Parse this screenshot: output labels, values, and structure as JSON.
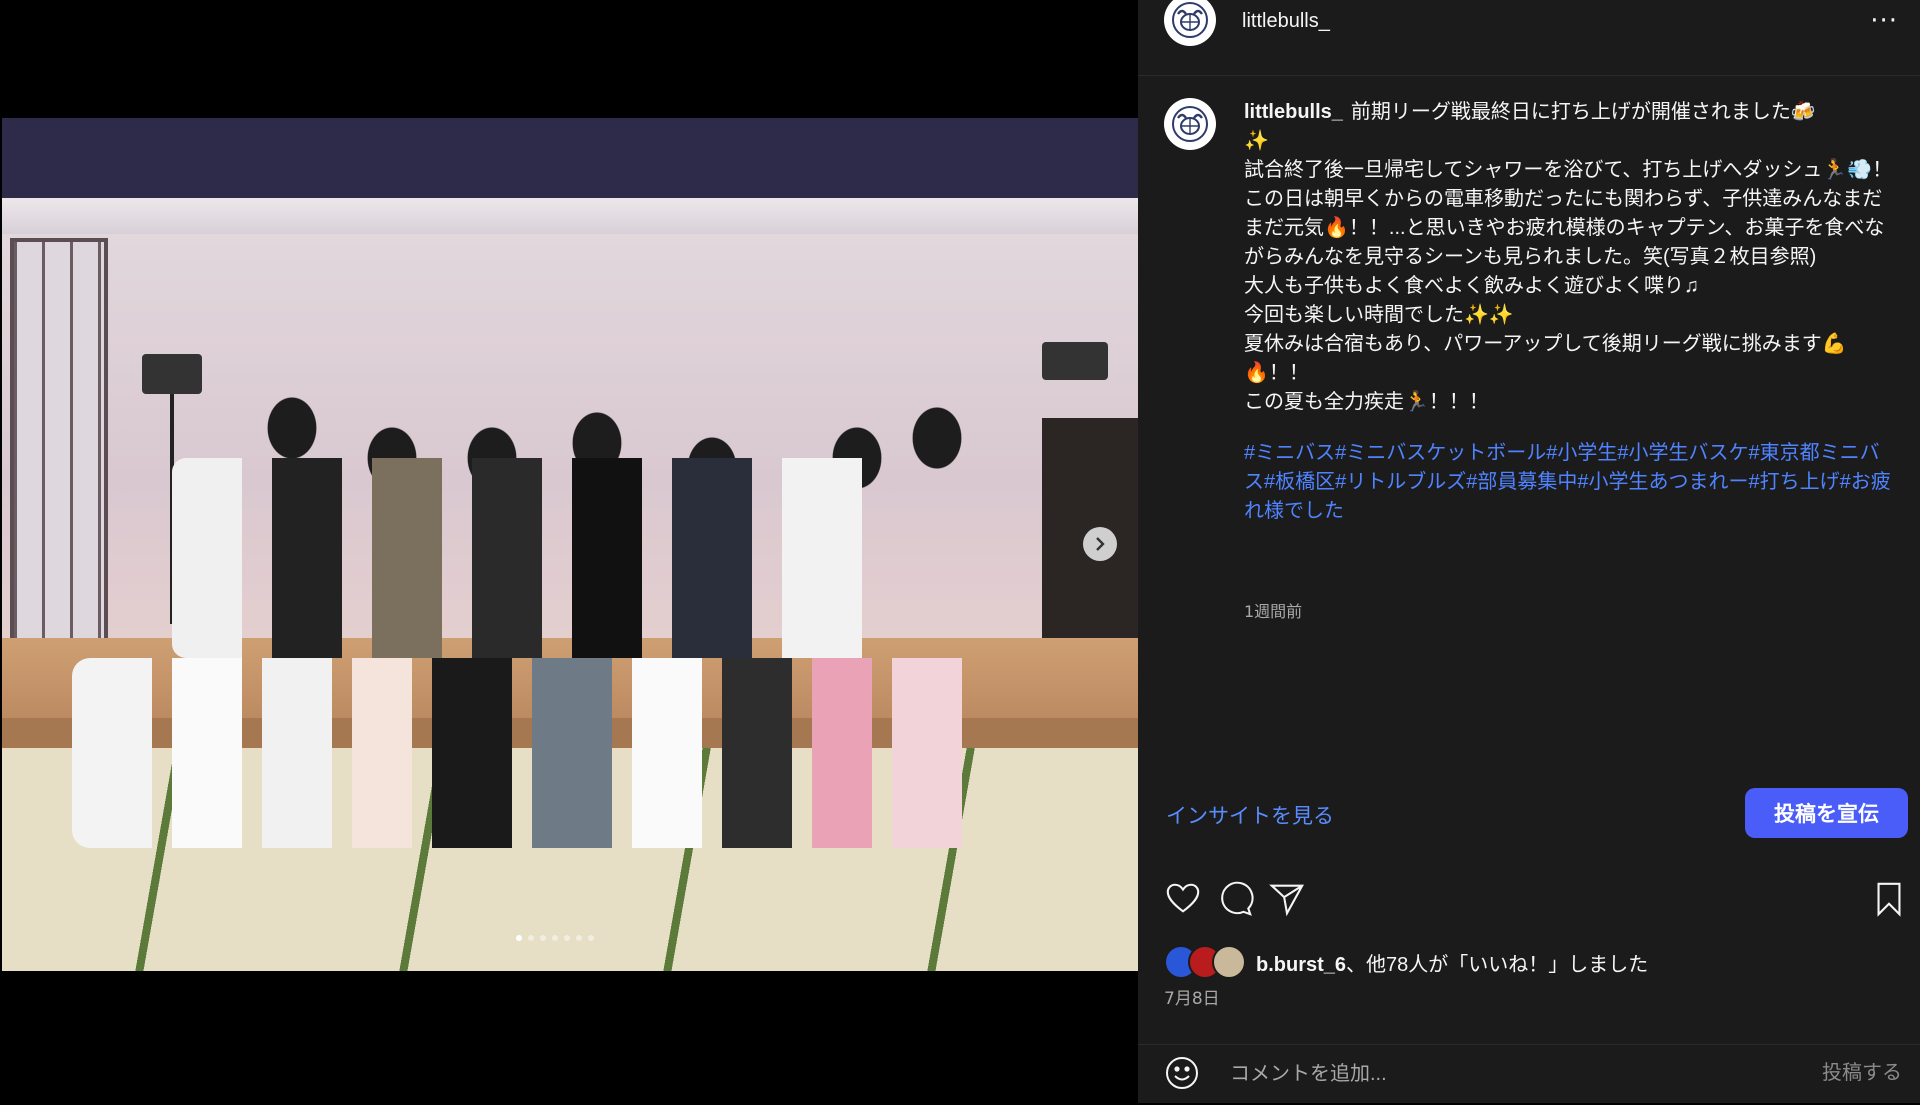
{
  "post": {
    "username": "littlebulls_",
    "more_label": "···",
    "caption_lines": [
      "前期リーグ戦最終日に打ち上げが開催されました🍻",
      "✨",
      "試合終了後一旦帰宅してシャワーを浴びて、打ち上げへダッシュ🏃💨！",
      "この日は朝早くからの電車移動だったにも関わらず、子供達みんなまだまだ元気🔥！！...と思いきやお疲れ模様のキャプテン、お菓子を食べながらみんなを見守るシーンも見られました。笑(写真２枚目参照)",
      "大人も子供もよく食べよく飲みよく遊びよく喋り♫",
      "今回も楽しい時間でした✨✨",
      "夏休みは合宿もあり、パワーアップして後期リーグ戦に挑みます💪🔥！！",
      "この夏も全力疾走🏃！！！"
    ],
    "hashtags": "#ミニバス#ミニバスケットボール#小学生#小学生バスケ#東京都ミニバス#板橋区#リトルブルズ#部員募集中#小学生あつまれー#打ち上げ#お疲れ様でした",
    "time_ago": "1週間前",
    "insight_label": "インサイトを見る",
    "promote_label": "投稿を宣伝",
    "likes_user": "b.burst_6",
    "likes_rest": "、他78人が「いいね！」しました",
    "date": "7月8日",
    "comment_placeholder": "コメントを追加...",
    "post_label": "投稿する"
  },
  "carousel": {
    "count": 7,
    "active": 1
  },
  "icons": [
    "team-logo-icon",
    "chevron-right-icon",
    "heart-icon",
    "comment-icon",
    "share-icon",
    "bookmark-icon",
    "emoji-icon"
  ],
  "colors": {
    "link": "#4f83ff",
    "button": "#4a5df9",
    "panel_bg": "#1b1b1b"
  }
}
